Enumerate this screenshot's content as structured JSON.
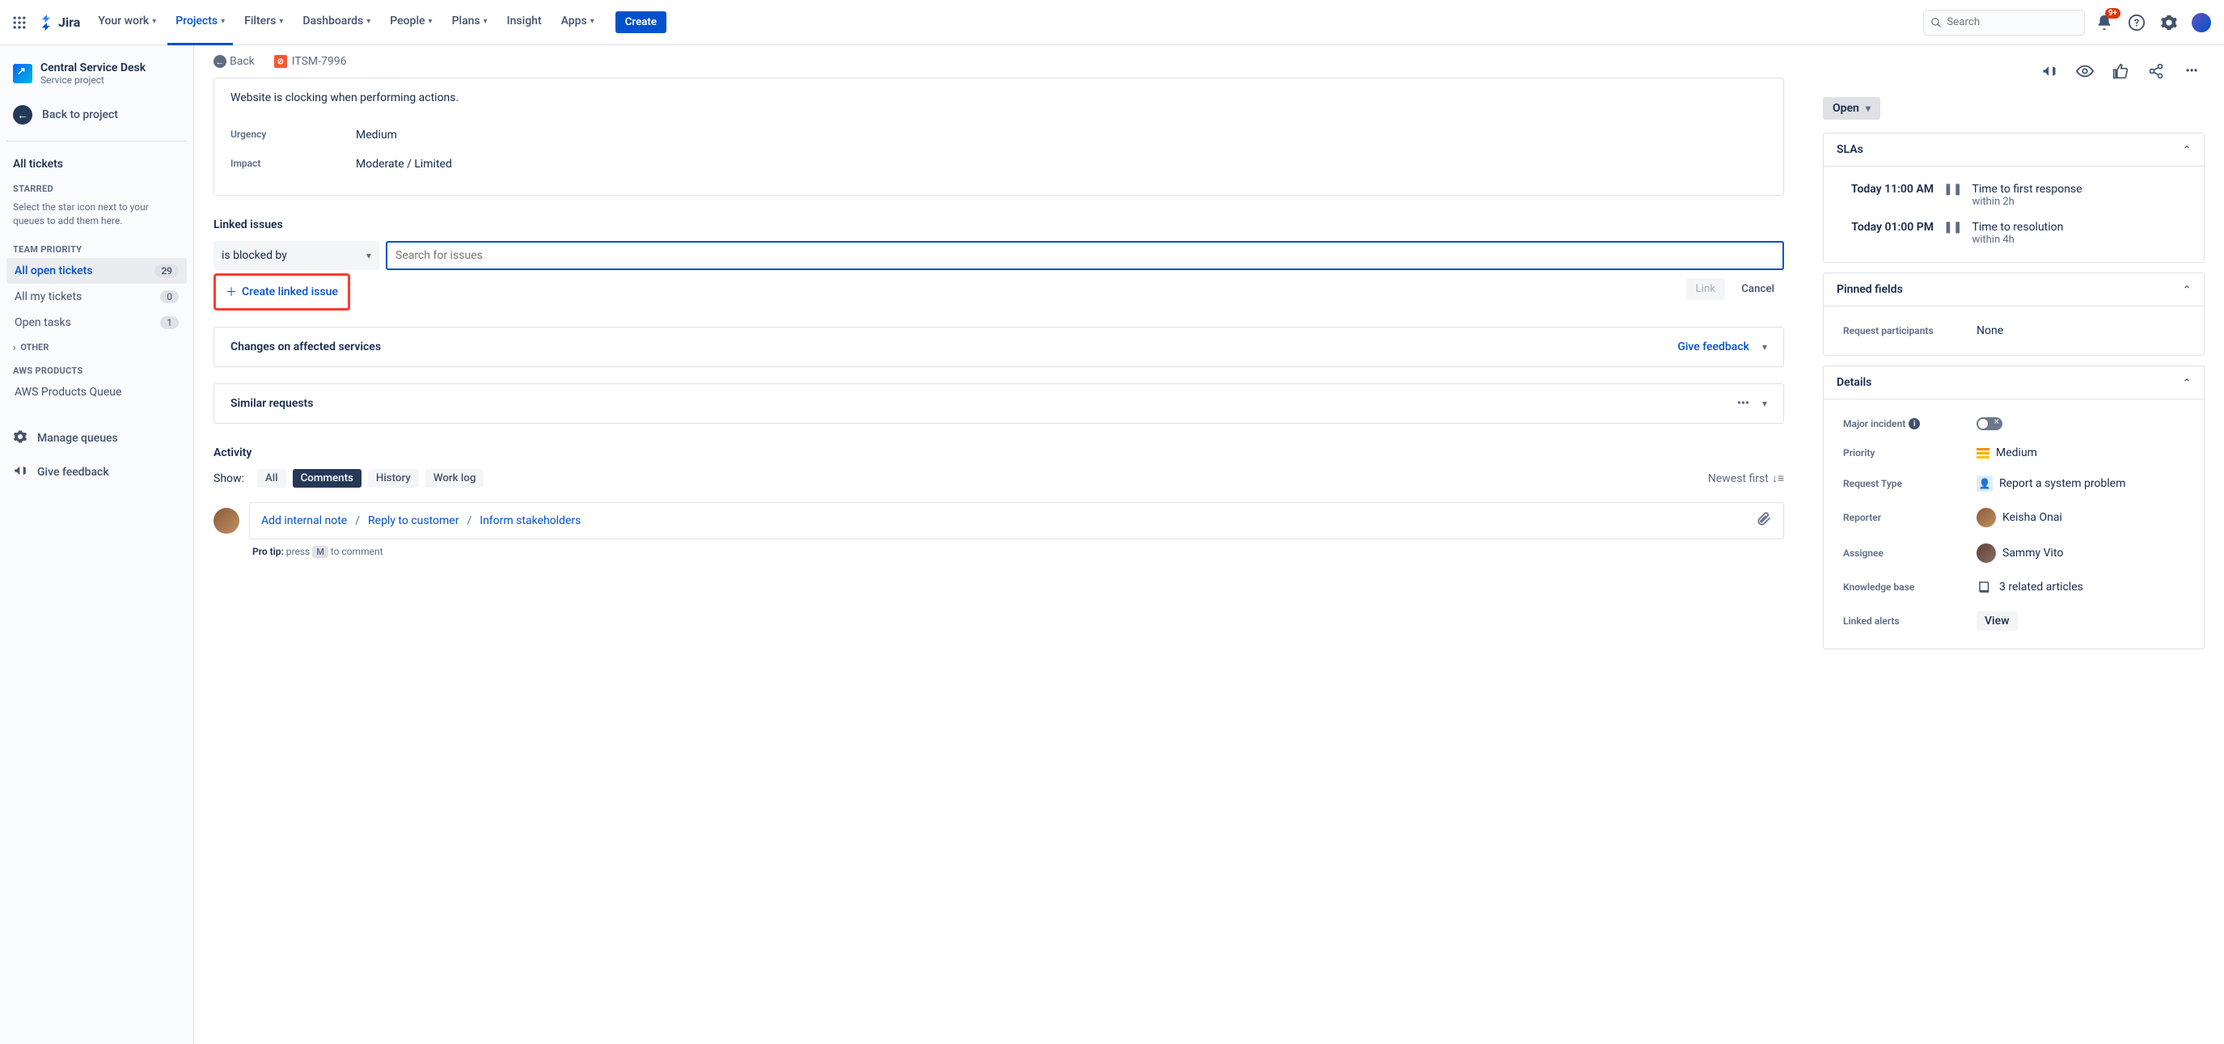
{
  "topbar": {
    "logo": "Jira",
    "nav": {
      "your_work": "Your work",
      "projects": "Projects",
      "filters": "Filters",
      "dashboards": "Dashboards",
      "people": "People",
      "plans": "Plans",
      "insight": "Insight",
      "apps": "Apps"
    },
    "create": "Create",
    "search_placeholder": "Search",
    "notifications_badge": "9+"
  },
  "sidebar": {
    "project_name": "Central Service Desk",
    "project_type": "Service project",
    "back_to_project": "Back to project",
    "all_tickets": "All tickets",
    "starred_label": "STARRED",
    "starred_help": "Select the star icon next to your queues to add them here.",
    "team_priority_label": "TEAM PRIORITY",
    "queues": [
      {
        "label": "All open tickets",
        "count": "29"
      },
      {
        "label": "All my tickets",
        "count": "0"
      },
      {
        "label": "Open tasks",
        "count": "1"
      }
    ],
    "other_label": "OTHER",
    "aws_label": "AWS PRODUCTS",
    "aws_queue": "AWS Products Queue",
    "manage_queues": "Manage queues",
    "give_feedback": "Give feedback"
  },
  "crumbs": {
    "back": "Back",
    "issue_key": "ITSM-7996"
  },
  "issue": {
    "description": "Website is clocking when performing actions.",
    "urgency_label": "Urgency",
    "urgency_value": "Medium",
    "impact_label": "Impact",
    "impact_value": "Moderate / Limited"
  },
  "linked": {
    "title": "Linked issues",
    "relation": "is blocked by",
    "search_placeholder": "Search for issues",
    "create_linked": "Create linked issue",
    "link_btn": "Link",
    "cancel_btn": "Cancel"
  },
  "changes_panel": {
    "title": "Changes on affected services",
    "feedback": "Give feedback"
  },
  "similar_panel": {
    "title": "Similar requests"
  },
  "activity": {
    "title": "Activity",
    "show_label": "Show:",
    "tabs": {
      "all": "All",
      "comments": "Comments",
      "history": "History",
      "work_log": "Work log"
    },
    "newest": "Newest first",
    "add_internal": "Add internal note",
    "reply": "Reply to customer",
    "inform": "Inform stakeholders",
    "pro_tip_label": "Pro tip:",
    "pro_tip_press": " press ",
    "pro_tip_key": "M",
    "pro_tip_rest": " to comment"
  },
  "right": {
    "status": "Open",
    "slas_title": "SLAs",
    "slas": [
      {
        "time": "Today 11:00 AM",
        "name": "Time to first response",
        "within": "within 2h"
      },
      {
        "time": "Today 01:00 PM",
        "name": "Time to resolution",
        "within": "within 4h"
      }
    ],
    "pinned_title": "Pinned fields",
    "request_participants_label": "Request participants",
    "request_participants_value": "None",
    "details_title": "Details",
    "major_incident_label": "Major incident",
    "priority_label": "Priority",
    "priority_value": "Medium",
    "request_type_label": "Request Type",
    "request_type_value": "Report a system problem",
    "reporter_label": "Reporter",
    "reporter_value": "Keisha Onai",
    "assignee_label": "Assignee",
    "assignee_value": "Sammy Vito",
    "knowledge_label": "Knowledge base",
    "knowledge_value": "3 related articles",
    "linked_alerts_label": "Linked alerts",
    "linked_alerts_value": "View"
  }
}
